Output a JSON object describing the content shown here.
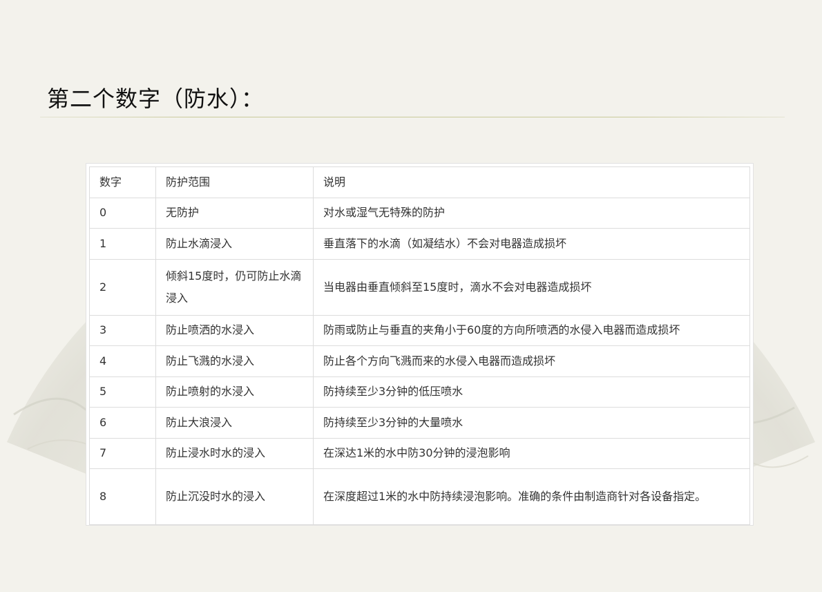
{
  "slide": {
    "title": "第二个数字（防水）："
  },
  "table": {
    "headers": [
      "数字",
      "防护范围",
      "说明"
    ],
    "rows": [
      {
        "digit": "0",
        "scope": "无防护",
        "desc": "对水或湿气无特殊的防护"
      },
      {
        "digit": "1",
        "scope": "防止水滴浸入",
        "desc": "垂直落下的水滴（如凝结水）不会对电器造成损坏"
      },
      {
        "digit": "2",
        "scope": "倾斜15度时，仍可防止水滴浸入",
        "desc": "当电器由垂直倾斜至15度时，滴水不会对电器造成损坏"
      },
      {
        "digit": "3",
        "scope": "防止喷洒的水浸入",
        "desc": "防雨或防止与垂直的夹角小于60度的方向所喷洒的水侵入电器而造成损坏"
      },
      {
        "digit": "4",
        "scope": "防止飞溅的水浸入",
        "desc": "防止各个方向飞溅而来的水侵入电器而造成损坏"
      },
      {
        "digit": "5",
        "scope": "防止喷射的水浸入",
        "desc": "防持续至少3分钟的低压喷水"
      },
      {
        "digit": "6",
        "scope": "防止大浪浸入",
        "desc": "防持续至少3分钟的大量喷水"
      },
      {
        "digit": "7",
        "scope": "防止浸水时水的浸入",
        "desc": "在深达1米的水中防30分钟的浸泡影响"
      },
      {
        "digit": "8",
        "scope": "防止沉没时水的浸入",
        "desc": "在深度超过1米的水中防持续浸泡影响。准确的条件由制造商针对各设备指定。"
      }
    ]
  }
}
